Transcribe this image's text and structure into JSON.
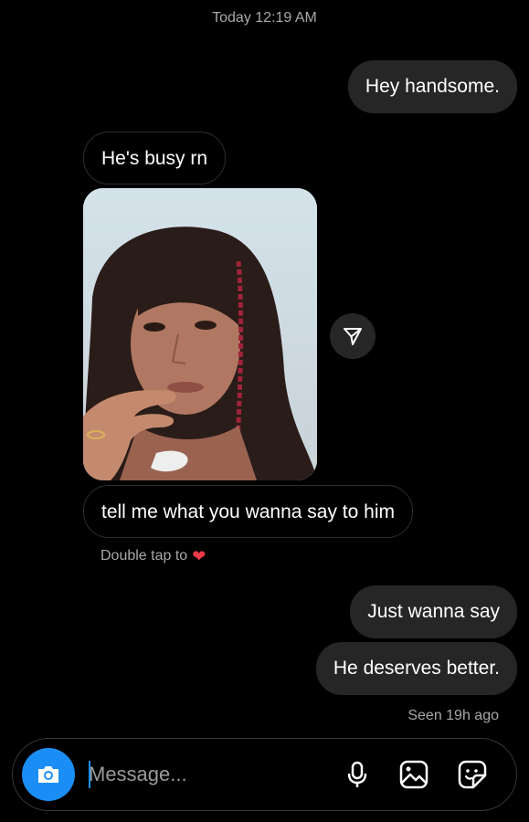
{
  "header": {
    "timestamp": "Today 12:19 AM"
  },
  "messages": [
    {
      "side": "sent",
      "text": "Hey handsome."
    },
    {
      "side": "received",
      "text": "He's busy rn"
    },
    {
      "side": "received",
      "type": "photo"
    },
    {
      "side": "received",
      "text": "tell me what you wanna say to him"
    },
    {
      "side": "sent",
      "text": "Just wanna say"
    },
    {
      "side": "sent",
      "text": "He deserves better."
    }
  ],
  "photo_hint": {
    "text": "Double tap to",
    "icon": "heart-icon",
    "color": "#ed3a4a"
  },
  "status": {
    "seen": "Seen 19h ago"
  },
  "composer": {
    "placeholder": "Message...",
    "accent": "#1a8ef5",
    "icons": [
      "camera-icon",
      "microphone-icon",
      "gallery-icon",
      "sticker-icon"
    ]
  }
}
